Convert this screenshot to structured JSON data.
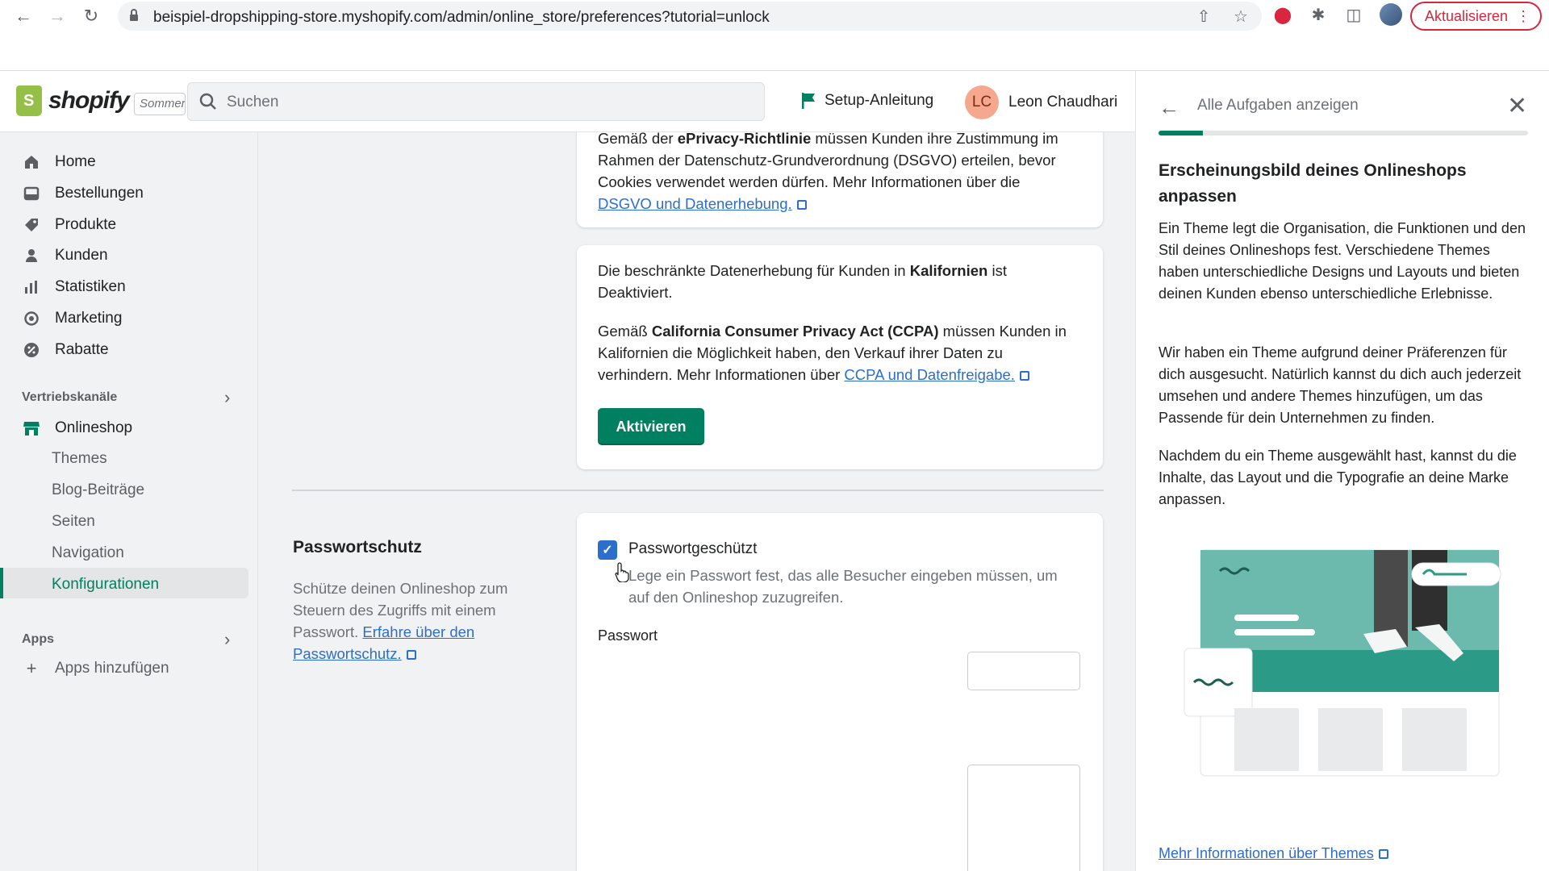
{
  "browser": {
    "url": "beispiel-dropshipping-store.myshopify.com/admin/online_store/preferences?tutorial=unlock",
    "update_label": "Aktualisieren"
  },
  "topbar": {
    "logo_text": "shopify",
    "store_tag": "Sommer",
    "search_placeholder": "Suchen",
    "setup_label": "Setup-Anleitung",
    "user_initials": "LC",
    "user_name": "Leon Chaudhari"
  },
  "sidebar": {
    "items": [
      {
        "label": "Home",
        "icon": "home-icon"
      },
      {
        "label": "Bestellungen",
        "icon": "orders-icon"
      },
      {
        "label": "Produkte",
        "icon": "tag-icon"
      },
      {
        "label": "Kunden",
        "icon": "person-icon"
      },
      {
        "label": "Statistiken",
        "icon": "bar-chart-icon"
      },
      {
        "label": "Marketing",
        "icon": "target-icon"
      },
      {
        "label": "Rabatte",
        "icon": "discount-icon"
      }
    ],
    "sales_channels_label": "Vertriebskanäle",
    "onlineshop_label": "Onlineshop",
    "sub_items": [
      "Themes",
      "Blog-Beiträge",
      "Seiten",
      "Navigation",
      "Konfigurationen"
    ],
    "apps_label": "Apps",
    "add_apps_label": "Apps hinzufügen"
  },
  "main": {
    "card1": {
      "line0_pre": "Gemäß der ",
      "line0_bold": "ePrivacy-Richtlinie",
      "line0_post": " müssen Kunden ihre Zustimmung im",
      "line1": "Rahmen der Datenschutz-Grundverordnung (DSGVO) erteilen, bevor",
      "line2": "Cookies verwendet werden dürfen. Mehr Informationen über die",
      "link": "DSGVO und Datenerhebung."
    },
    "card2": {
      "p1_pre": "Die beschränkte Datenerhebung für Kunden in ",
      "p1_bold": "Kalifornien",
      "p1_post": " ist",
      "p1_line2": "Deaktiviert.",
      "p2_pre": "Gemäß ",
      "p2_bold": "California Consumer Privacy Act (CCPA)",
      "p2_post": " müssen Kunden in",
      "p2_line2": "Kalifornien die Möglichkeit haben, den Verkauf ihrer Daten zu",
      "p2_line3_pre": "verhindern. Mehr Informationen über ",
      "p2_link": "CCPA und Datenfreigabe.",
      "button": "Aktivieren"
    },
    "password_section": {
      "title": "Passwortschutz",
      "desc_line1": "Schütze deinen Onlineshop zum",
      "desc_line2": "Steuern des Zugriffs mit einem",
      "desc_line3_pre": "Passwort. ",
      "desc_link1": "Erfahre über den",
      "desc_link2": "Passwortschutz.",
      "checkbox_label": "Passwortgeschützt",
      "checkbox_checked": true,
      "checkbox_help_line1": "Lege ein Passwort fest, das alle Besucher eingeben müssen, um",
      "checkbox_help_line2": "auf den Onlineshop zuzugreifen.",
      "password_label": "Passwort"
    }
  },
  "panel": {
    "back_label": "Alle Aufgaben anzeigen",
    "progress": 0.12,
    "heading": "Erscheinungsbild deines Onlineshops anpassen",
    "p1": "Ein Theme legt die Organisation, die Funktionen und den Stil deines Onlineshops fest. Verschiedene Themes haben unterschiedliche Designs und Layouts und bieten deinen Kunden ebenso unterschiedliche Erlebnisse.",
    "p2": "Wir haben ein Theme aufgrund deiner Präferenzen für dich ausgesucht. Natürlich kannst du dich auch jederzeit umsehen und andere Themes hinzufügen, um das Passende für dein Unternehmen zu finden.",
    "p3": "Nachdem du ein Theme ausgewählt hast, kannst du die Inhalte, das Layout und die Typografie an deine Marke anpassen.",
    "more_link": "Mehr Informationen über Themes"
  },
  "colors": {
    "primary": "#008060",
    "link": "#2c6ecb",
    "update_red": "#d7263d"
  }
}
